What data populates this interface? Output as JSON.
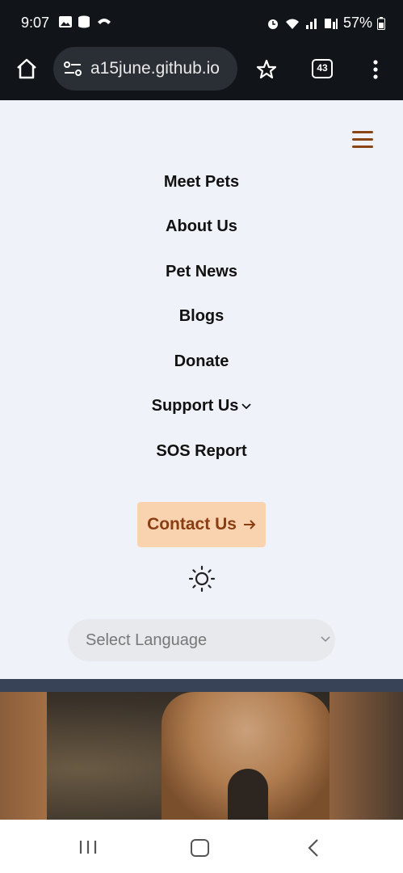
{
  "status_bar": {
    "time": "9:07",
    "battery": "57%",
    "left_icons": [
      "image-icon",
      "database-icon",
      "call-icon"
    ],
    "right_icons": [
      "alarm-icon",
      "wifi-icon",
      "signal-icon",
      "volte-icon",
      "signal-icon",
      "battery-icon"
    ]
  },
  "browser": {
    "url": "a15june.github.io",
    "tab_count": "43"
  },
  "site_menu": {
    "items": [
      {
        "label": "Meet Pets"
      },
      {
        "label": "About Us"
      },
      {
        "label": "Pet News"
      },
      {
        "label": "Blogs"
      },
      {
        "label": "Donate"
      },
      {
        "label": "Support Us",
        "has_dropdown": true
      },
      {
        "label": "SOS Report"
      }
    ],
    "contact_label": "Contact Us",
    "theme_icon": "sun-icon",
    "language_placeholder": "Select Language"
  },
  "colors": {
    "accent": "#8b4513",
    "contact_bg": "#f9d3b0",
    "page_bg": "#eff2f8"
  }
}
